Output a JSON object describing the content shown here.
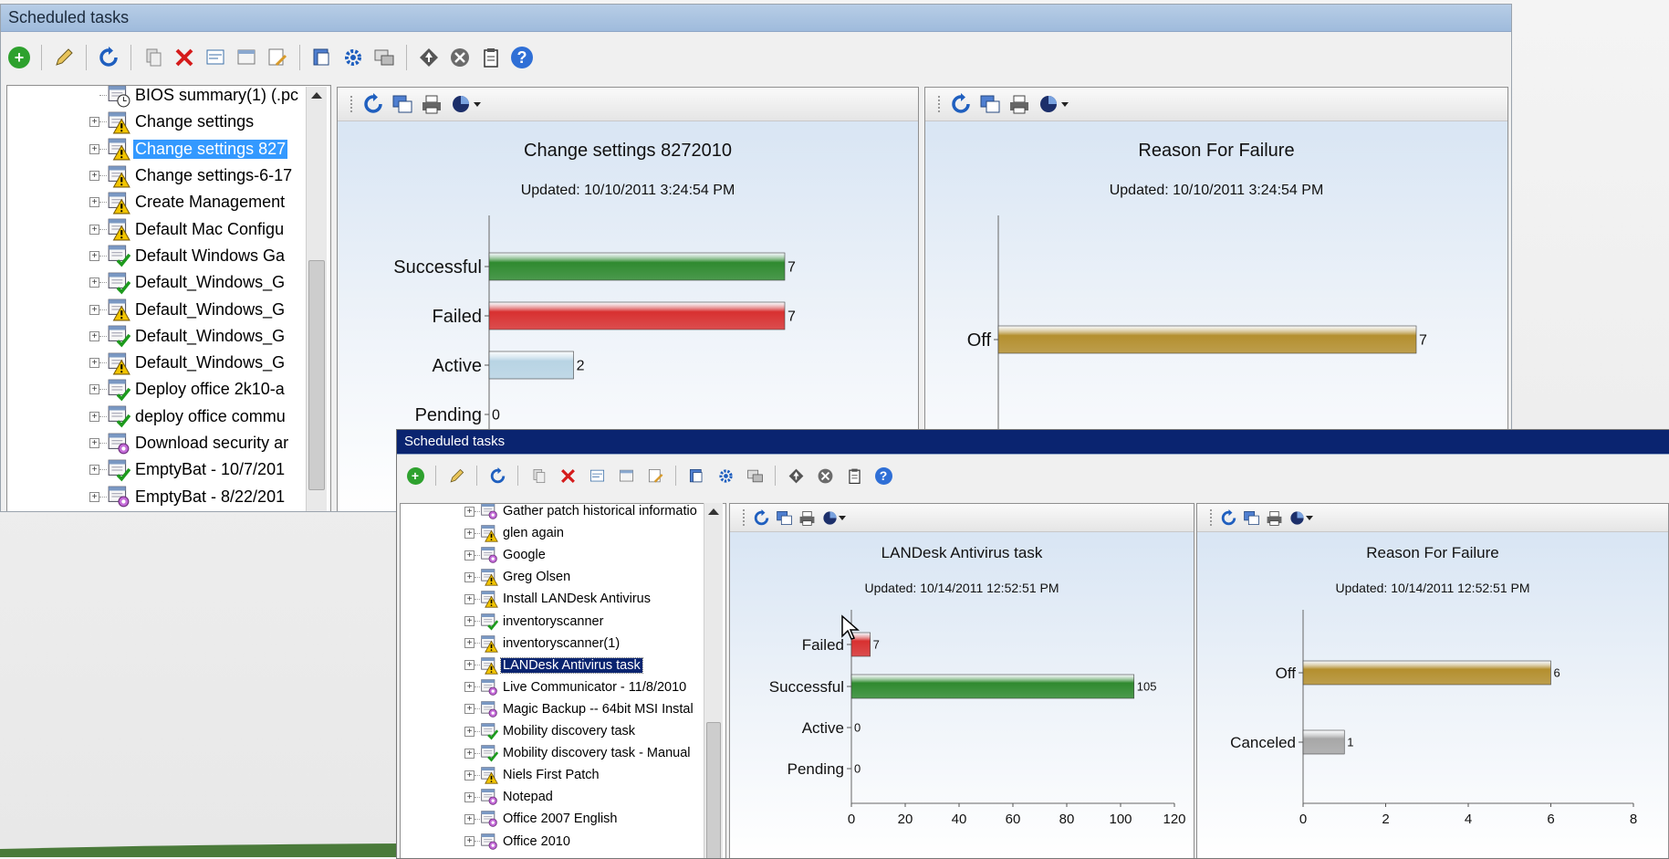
{
  "colors": {
    "success": "#2f8a2f",
    "failed": "#d83030",
    "active": "#b8d4e4",
    "off": "#b48f2e",
    "canceled": "#a7a7a7",
    "selection": "#3399ff",
    "title_back": "#0a2470"
  },
  "back_window": {
    "title": "Scheduled tasks",
    "toolbar_icons": [
      "add-icon",
      "edit-icon",
      "refresh-icon",
      "copy-icon",
      "delete-icon",
      "properties-icon",
      "schedule-icon",
      "report-icon",
      "export-icon",
      "settings-icon",
      "targets-icon",
      "start-icon",
      "cancel-icon",
      "clipboard-icon",
      "help-icon"
    ],
    "tree_items": [
      {
        "label": "BIOS summary(1) (.pc",
        "icon": "clock"
      },
      {
        "label": "Change settings",
        "icon": "warning"
      },
      {
        "label": "Change settings 827",
        "icon": "warning",
        "selected": true
      },
      {
        "label": "Change settings-6-17",
        "icon": "warning"
      },
      {
        "label": "Create Management",
        "icon": "warning"
      },
      {
        "label": "Default Mac Configu",
        "icon": "warning"
      },
      {
        "label": "Default Windows Ga",
        "icon": "check"
      },
      {
        "label": "Default_Windows_G",
        "icon": "check"
      },
      {
        "label": "Default_Windows_G",
        "icon": "warning"
      },
      {
        "label": "Default_Windows_G",
        "icon": "check"
      },
      {
        "label": "Default_Windows_G",
        "icon": "warning"
      },
      {
        "label": "Deploy office 2k10-a",
        "icon": "check"
      },
      {
        "label": "deploy office commu",
        "icon": "check"
      },
      {
        "label": "Download security ar",
        "icon": "gear"
      },
      {
        "label": "EmptyBat - 10/7/201",
        "icon": "check"
      },
      {
        "label": "EmptyBat - 8/22/201",
        "icon": "gear"
      }
    ],
    "charts": [
      {
        "title": "Change settings 8272010",
        "updated": "Updated: 10/10/2011 3:24:54 PM",
        "chart_data": {
          "type": "bar",
          "categories": [
            "Successful",
            "Failed",
            "Active",
            "Pending"
          ],
          "values": [
            7,
            7,
            2,
            0
          ],
          "colors": [
            "success",
            "failed",
            "active",
            "active"
          ]
        }
      },
      {
        "title": "Reason For Failure",
        "updated": "Updated: 10/10/2011 3:24:54 PM",
        "chart_data": {
          "type": "bar",
          "categories": [
            "Off"
          ],
          "values": [
            7
          ],
          "colors": [
            "off"
          ]
        }
      }
    ]
  },
  "front_window": {
    "title": "Scheduled tasks",
    "tree_items": [
      {
        "label": "Gather patch historical informatio",
        "icon": "gear"
      },
      {
        "label": "glen again",
        "icon": "warning"
      },
      {
        "label": "Google",
        "icon": "gear"
      },
      {
        "label": "Greg Olsen",
        "icon": "warning"
      },
      {
        "label": "Install LANDesk Antivirus",
        "icon": "warning"
      },
      {
        "label": "inventoryscanner",
        "icon": "check"
      },
      {
        "label": "inventoryscanner(1)",
        "icon": "warning"
      },
      {
        "label": "LANDesk Antivirus task",
        "icon": "warning",
        "selected": true
      },
      {
        "label": "Live Communicator - 11/8/2010",
        "icon": "gear"
      },
      {
        "label": "Magic Backup -- 64bit MSI Instal",
        "icon": "gear"
      },
      {
        "label": "Mobility discovery task",
        "icon": "check"
      },
      {
        "label": "Mobility discovery task - Manual",
        "icon": "check"
      },
      {
        "label": "Niels First Patch",
        "icon": "warning"
      },
      {
        "label": "Notepad",
        "icon": "gear"
      },
      {
        "label": "Office 2007 English",
        "icon": "gear"
      },
      {
        "label": "Office 2010",
        "icon": "gear"
      }
    ],
    "charts": [
      {
        "title": "LANDesk Antivirus task",
        "updated": "Updated: 10/14/2011 12:52:51 PM",
        "chart_data": {
          "type": "bar",
          "categories": [
            "Failed",
            "Successful",
            "Active",
            "Pending"
          ],
          "values": [
            7,
            105,
            0,
            0
          ],
          "colors": [
            "failed",
            "success",
            "active",
            "active"
          ],
          "xlim": [
            0,
            120
          ],
          "xticks": [
            "0",
            "20",
            "40",
            "60",
            "80",
            "100",
            "120"
          ]
        }
      },
      {
        "title": "Reason For Failure",
        "updated": "Updated: 10/14/2011 12:52:51 PM",
        "chart_data": {
          "type": "bar",
          "categories": [
            "Off",
            "Canceled"
          ],
          "values": [
            6,
            1
          ],
          "colors": [
            "off",
            "canceled"
          ],
          "xlim": [
            0,
            8
          ],
          "xticks": [
            "0",
            "2",
            "4",
            "6",
            "8"
          ]
        }
      }
    ]
  }
}
